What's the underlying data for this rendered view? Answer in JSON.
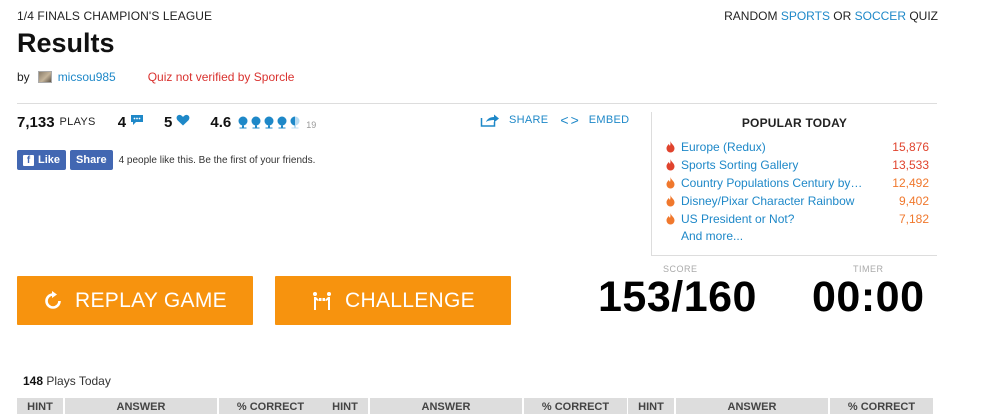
{
  "breadcrumb": "1/4 FINALS CHAMPION'S LEAGUE",
  "random": {
    "prefix": "RANDOM",
    "sports": "SPORTS",
    "or": "OR",
    "soccer": "SOCCER",
    "suffix": "QUIZ"
  },
  "title": "Results",
  "byline": {
    "by": "by",
    "author": "micsou985",
    "verification": "Quiz not verified by Sporcle"
  },
  "stats": {
    "plays": "7,133",
    "plays_label": "PLAYS",
    "comments": "4",
    "likes": "5",
    "rating": "4.6",
    "rating_count": "19"
  },
  "share": {
    "share_label": "SHARE",
    "embed_label": "EMBED",
    "embed_glyph": "<>"
  },
  "facebook": {
    "like_label": "Like",
    "share_label": "Share",
    "text": "4 people like this. Be the first of your friends."
  },
  "popular": {
    "title": "POPULAR TODAY",
    "items": [
      {
        "name": "Europe (Redux)",
        "count": "15,876",
        "color": "#e0432d"
      },
      {
        "name": "Sports Sorting Gallery",
        "count": "13,533",
        "color": "#e0432d"
      },
      {
        "name": "Country Populations Century by…",
        "count": "12,492",
        "color": "#f0782d"
      },
      {
        "name": "Disney/Pixar Character Rainbow",
        "count": "9,402",
        "color": "#f0782d"
      },
      {
        "name": "US President or Not?",
        "count": "7,182",
        "color": "#f0782d"
      }
    ],
    "more": "And more..."
  },
  "buttons": {
    "replay": "REPLAY GAME",
    "challenge": "CHALLENGE"
  },
  "score": {
    "label": "SCORE",
    "value": "153/160"
  },
  "timer": {
    "label": "TIMER",
    "value": "00:00"
  },
  "plays_today": {
    "count": "148",
    "label": "Plays Today"
  },
  "table_headers": [
    {
      "hint": "HINT",
      "answer": "ANSWER",
      "pct": "% CORRECT"
    },
    {
      "hint": "HINT",
      "answer": "ANSWER",
      "pct": "% CORRECT"
    },
    {
      "hint": "HINT",
      "answer": "ANSWER",
      "pct": "% CORRECT"
    }
  ],
  "colors": {
    "accent": "#1e88c8",
    "orange": "#f7930e",
    "warning": "#d9322f"
  }
}
